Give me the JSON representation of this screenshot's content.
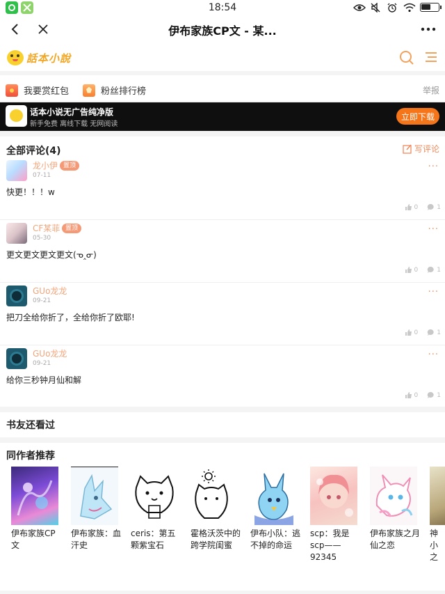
{
  "status_bar": {
    "time": "18:54"
  },
  "nav": {
    "title": "伊布家族CP文 - 某..."
  },
  "logo": {
    "text": "話本小說"
  },
  "actions": {
    "reward": "我要赏红包",
    "fans_rank": "粉丝排行榜",
    "report": "举报"
  },
  "ad": {
    "title": "话本小说无广告纯净版",
    "subtitle": "新手免费 离线下载 无网阅读",
    "button": "立即下载"
  },
  "comments": {
    "header": "全部评论(4)",
    "write_label": "写评论",
    "items": [
      {
        "user": "龙小伊",
        "badge": "置顶",
        "date": "07-11",
        "text": "快更！！！w",
        "likes": "0",
        "replies": "1"
      },
      {
        "user": "CF某菲",
        "badge": "置顶",
        "date": "05-30",
        "text": "更文更文更文更文(ᓀ‸ᓂ)",
        "likes": "0",
        "replies": "1"
      },
      {
        "user": "GUo龙龙",
        "badge": "",
        "date": "09-21",
        "text": "把刀全给你折了，全给你折了欧耶!",
        "likes": "0",
        "replies": "1"
      },
      {
        "user": "GUo龙龙",
        "badge": "",
        "date": "09-21",
        "text": "给你三秒钟月仙和解",
        "likes": "0",
        "replies": "1"
      }
    ]
  },
  "sections": {
    "also_read": "书友还看过",
    "same_author": "同作者推荐"
  },
  "books": [
    {
      "title": "伊布家族CP文"
    },
    {
      "title": "伊布家族：血汗史"
    },
    {
      "title": "ceris：第五颗紫宝石"
    },
    {
      "title": "霍格沃茨中的跨学院闺蜜"
    },
    {
      "title": "伊布小队：逃不掉的命运"
    },
    {
      "title": "scp：我是scp——92345"
    },
    {
      "title": "伊布家族之月仙之恋"
    },
    {
      "title": "神小之"
    }
  ],
  "colors": {
    "accent": "#f5761a",
    "username": "#f0a57b",
    "badge": "#f49a77"
  }
}
